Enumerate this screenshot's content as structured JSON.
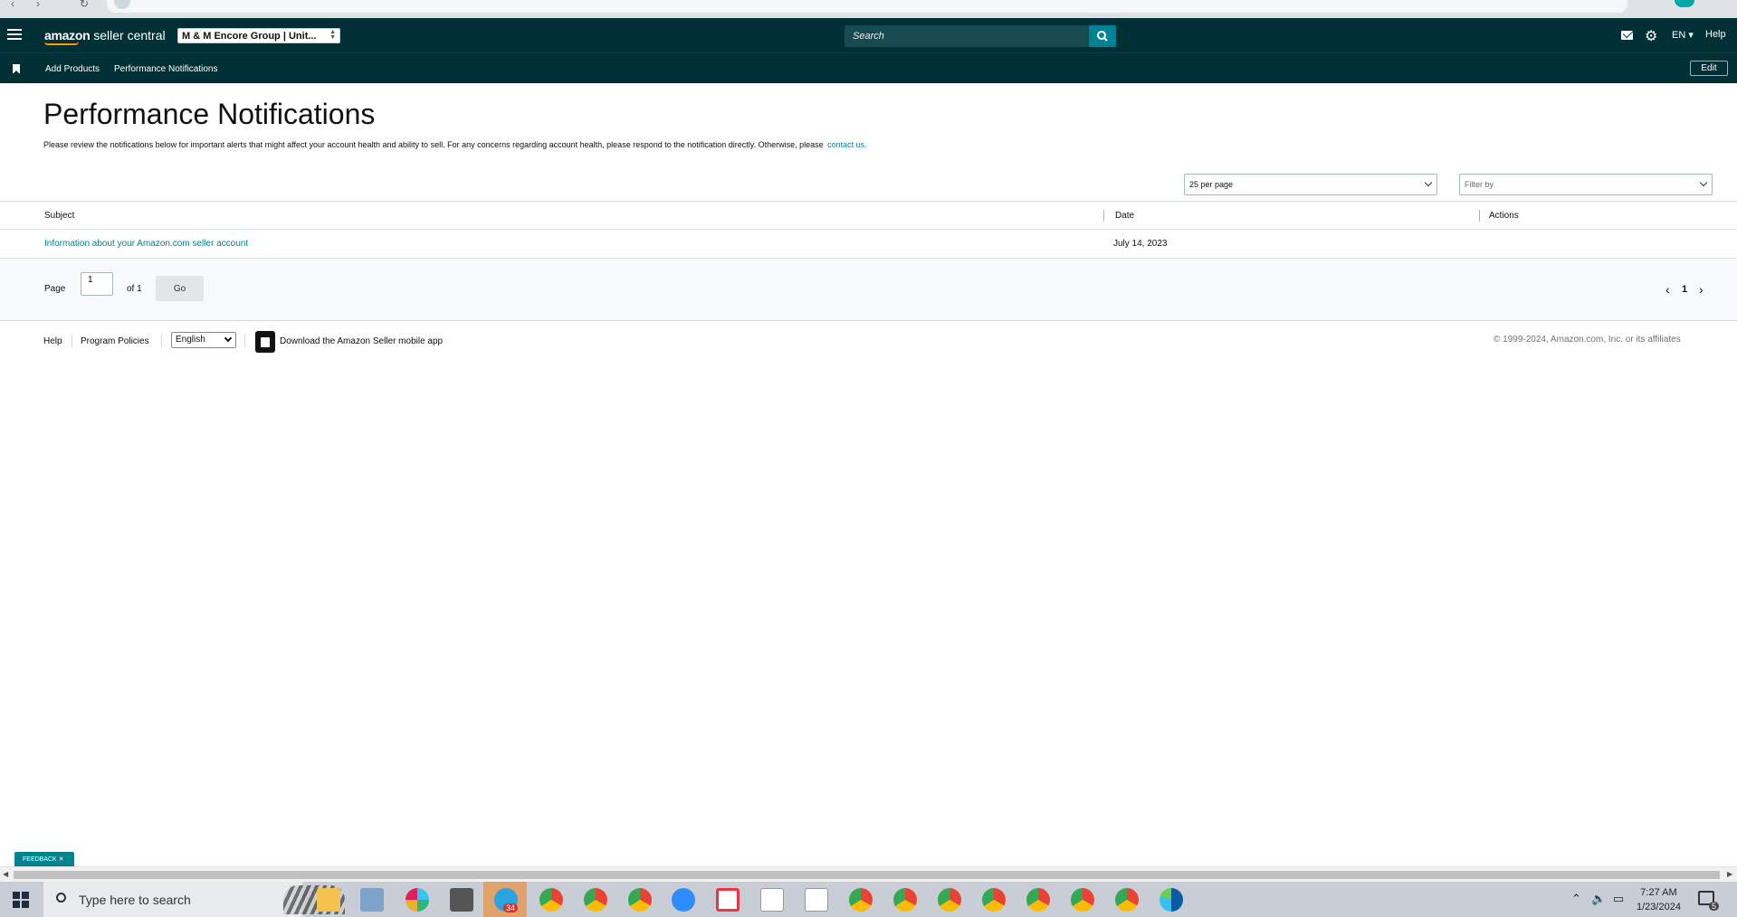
{
  "browser": {
    "url": "sellercentral.amazon.com/performance/notifications"
  },
  "topbar": {
    "logo_brand": "amazon",
    "logo_product": "seller central",
    "account": "M & M Encore Group | Unit...",
    "search_placeholder": "Search",
    "language": "EN ▾",
    "help": "Help"
  },
  "bookmarks": {
    "items": [
      "Add Products",
      "Performance Notifications"
    ],
    "edit_label": "Edit"
  },
  "main": {
    "title": "Performance Notifications",
    "description": "Please review the notifications below for important alerts that might affect your account health and ability to sell. For any concerns regarding account health, please respond to the notification directly. Otherwise, please",
    "contact_link": "contact us.",
    "per_page": "25 per page",
    "filter_placeholder": "Filter by"
  },
  "table": {
    "columns": [
      "Subject",
      "Date",
      "Actions"
    ],
    "rows": [
      {
        "subject": "Information about your Amazon.com seller account",
        "date": "July 14, 2023",
        "actions": ""
      }
    ]
  },
  "pagination": {
    "page_label": "Page",
    "current_page": "1",
    "of_label": "of 1",
    "go_label": "Go",
    "page_number": "1"
  },
  "footer": {
    "help": "Help",
    "program_policies": "Program Policies",
    "language": "English",
    "app_download": "Download the Amazon Seller mobile app",
    "copyright": "© 1999-2024, Amazon.com, Inc. or its affiliates"
  },
  "feedback": "FEEDBACK ✕",
  "taskbar": {
    "search_placeholder": "Type here to search",
    "time": "7:27 AM",
    "date": "1/23/2024",
    "telegram_badge": "34",
    "notification_count": "5"
  },
  "colors": {
    "nav_bg": "#002f36",
    "accent": "#008296",
    "link": "#008296"
  }
}
